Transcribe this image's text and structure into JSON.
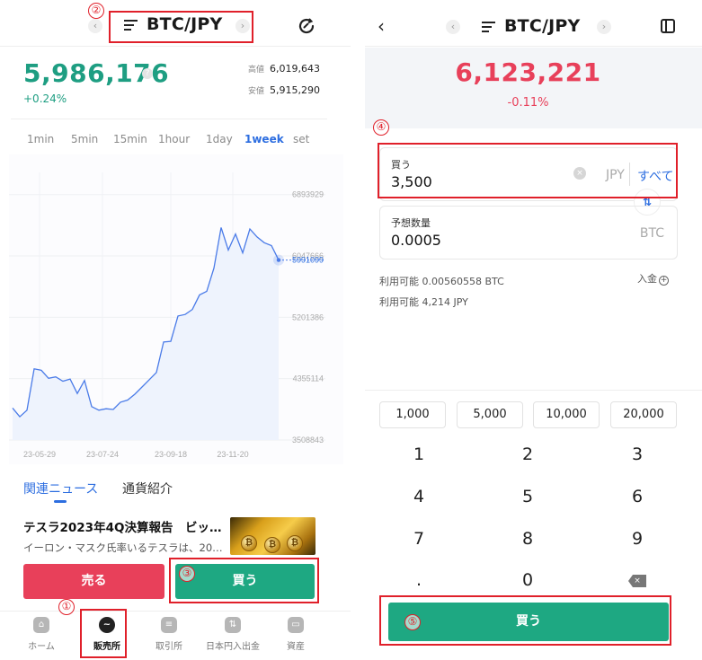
{
  "left": {
    "header": {
      "pair": "BTC/JPY",
      "prev": "‹",
      "next": "›"
    },
    "price": {
      "current": "5,986,176",
      "help": "?",
      "change": "+0.24%",
      "high_label": "高値",
      "high_value": "6,019,643",
      "low_label": "安値",
      "low_value": "5,915,290"
    },
    "timeframes": [
      "1min",
      "5min",
      "15min",
      "1hour",
      "1day",
      "1week",
      "set"
    ],
    "active_timeframe": "1week",
    "news": {
      "tabs": [
        "関連ニュース",
        "通貨紹介"
      ],
      "title": "テスラ2023年4Q決算報告　ビッ…",
      "summary": "イーロン・マスク氏率いるテスラは、20…"
    },
    "actions": {
      "sell": "売る",
      "buy": "買う"
    },
    "nav": [
      {
        "label": "ホーム",
        "icon": "home-icon"
      },
      {
        "label": "販売所",
        "icon": "exchange-icon"
      },
      {
        "label": "取引所",
        "icon": "trade-icon"
      },
      {
        "label": "日本円入出金",
        "icon": "deposit-icon"
      },
      {
        "label": "資産",
        "icon": "wallet-icon"
      }
    ]
  },
  "chart_data": {
    "type": "line",
    "x_tick_labels": [
      "23-05-29",
      "23-07-24",
      "23-09-18",
      "23-11-20"
    ],
    "y_tick_labels": [
      "6893929",
      "6047666",
      "5201386",
      "4355114",
      "3508843"
    ],
    "ylim": [
      3508843,
      7200000
    ],
    "current_label": "5991099",
    "values": [
      3950000,
      3830000,
      3920000,
      4490000,
      4470000,
      4360000,
      4380000,
      4320000,
      4350000,
      4150000,
      4330000,
      3970000,
      3920000,
      3940000,
      3930000,
      4030000,
      4060000,
      4140000,
      4240000,
      4340000,
      4440000,
      4860000,
      4870000,
      5220000,
      5240000,
      5310000,
      5510000,
      5560000,
      5880000,
      6440000,
      6130000,
      6350000,
      6090000,
      6420000,
      6310000,
      6230000,
      6190000,
      5991099
    ],
    "line_color": "#4a7be8"
  },
  "right": {
    "header": {
      "back": "‹",
      "pair": "BTC/JPY",
      "prev": "‹",
      "next": "›"
    },
    "price": {
      "current": "6,123,221",
      "change": "-0.11%"
    },
    "buy_field": {
      "label": "買う",
      "value": "3,500",
      "unit": "JPY",
      "clear": "×",
      "all": "すべて"
    },
    "swap": "⇅",
    "est_field": {
      "label": "予想数量",
      "value": "0.0005",
      "unit": "BTC"
    },
    "available_btc": "利用可能 0.00560558 BTC",
    "available_jpy": "利用可能 4,214 JPY",
    "deposit": "入金",
    "deposit_plus": "+",
    "presets": [
      "1,000",
      "5,000",
      "10,000",
      "20,000"
    ],
    "keys": [
      "1",
      "2",
      "3",
      "4",
      "5",
      "6",
      "7",
      "8",
      "9",
      ".",
      "0"
    ],
    "backspace": "×",
    "buy": "買う"
  },
  "annotations": [
    "①",
    "②",
    "③",
    "④",
    "⑤"
  ]
}
